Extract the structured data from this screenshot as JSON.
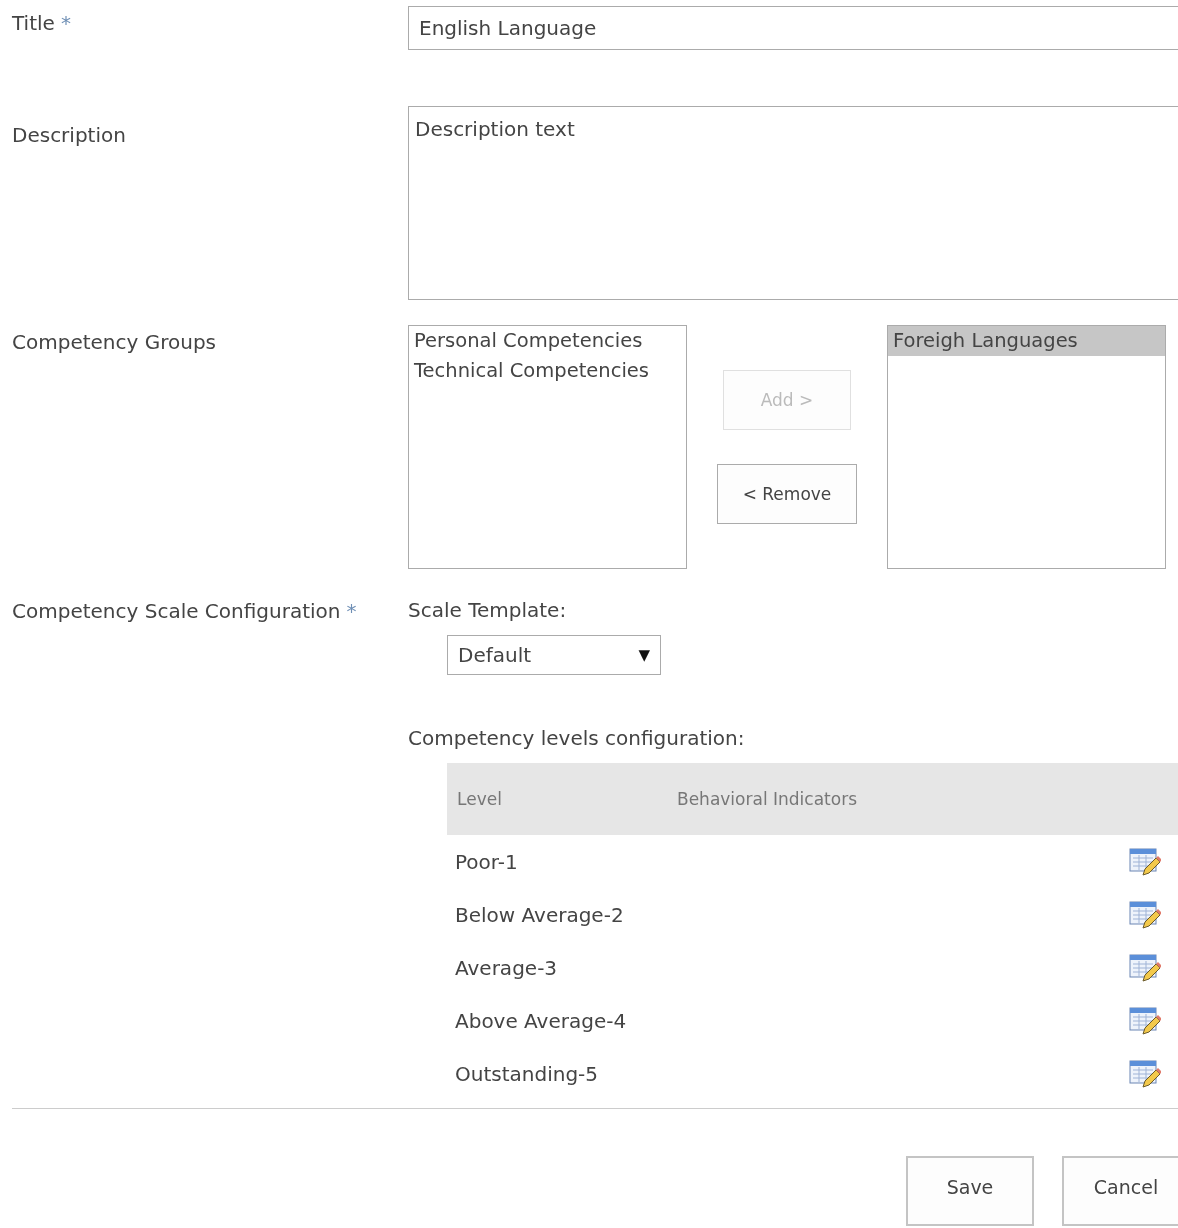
{
  "fields": [
    {
      "kind": "text",
      "label": "Title",
      "required_mark": "*",
      "value": "English Language"
    },
    {
      "kind": "textarea",
      "label": "Description",
      "value": "Description text"
    }
  ],
  "competency_groups": {
    "label": "Competency Groups",
    "available": [
      {
        "label": "Personal Competencies",
        "selected": false
      },
      {
        "label": "Technical Competencies",
        "selected": false
      }
    ],
    "add_button": {
      "label": "Add >",
      "disabled": true
    },
    "remove_button": {
      "label": "< Remove",
      "disabled": false
    },
    "chosen": [
      {
        "label": "Foreigh Languages",
        "selected": true
      }
    ]
  },
  "scale_configuration": {
    "label": "Competency Scale Configuration",
    "required_mark": "*",
    "template_label": "Scale Template:",
    "template_value": "Default",
    "dropdown_arrow": "▼",
    "levels_label": "Competency levels configuration:",
    "table": {
      "columns": [
        "Level",
        "Behavioral Indicators"
      ],
      "rows": [
        {
          "level": "Poor-1"
        },
        {
          "level": "Below Average-2"
        },
        {
          "level": "Average-3"
        },
        {
          "level": "Above Average-4"
        },
        {
          "level": "Outstanding-5"
        }
      ]
    }
  },
  "buttons": [
    "Save",
    "Cancel"
  ]
}
